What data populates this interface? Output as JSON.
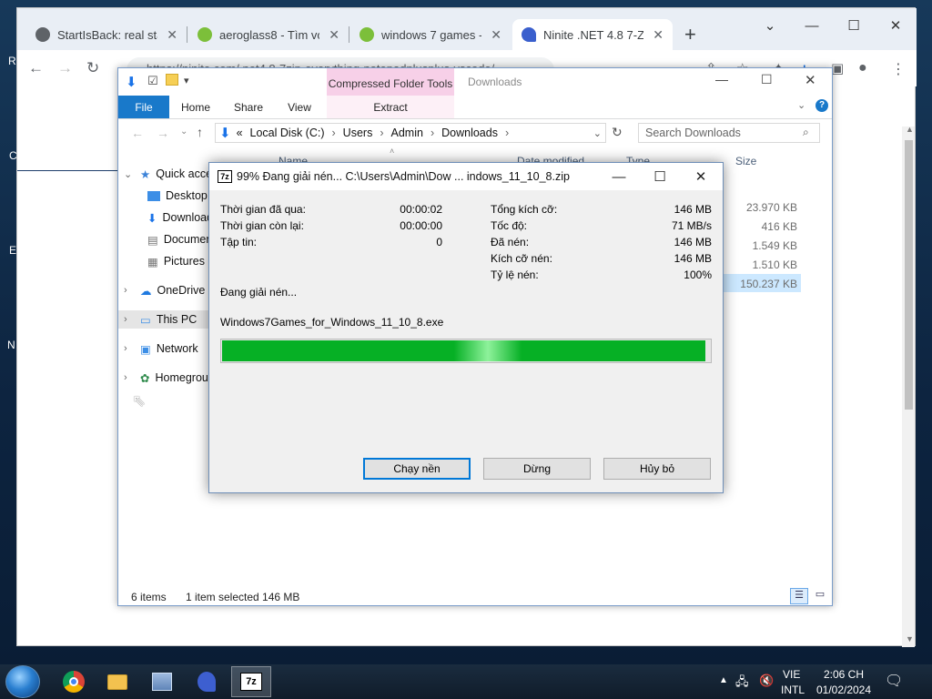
{
  "desktop": {
    "letters": [
      "R",
      "C",
      "E",
      "N"
    ]
  },
  "browser": {
    "tabs": [
      {
        "title": "StartIsBack: real start",
        "icon": "globe-icon"
      },
      {
        "title": "aeroglass8 - Tìm với",
        "icon": "google-favicon"
      },
      {
        "title": "windows 7 games - T",
        "icon": "google-favicon"
      },
      {
        "title": "Ninite .NET 4.8 7-Zip",
        "icon": "ninite-favicon"
      }
    ],
    "new_tab": "+",
    "url": "https://ninite.com/.net4.8-7zip-everything-notepadplusplus-vscode/"
  },
  "explorer": {
    "context_group": "Compressed Folder Tools",
    "window_title": "Downloads",
    "ribbon_tabs": [
      "File",
      "Home",
      "Share",
      "View"
    ],
    "context_tab": "Extract",
    "address": {
      "prefix": "«",
      "parts": [
        "Local Disk (C:)",
        "Users",
        "Admin",
        "Downloads"
      ]
    },
    "search_placeholder": "Search Downloads",
    "columns": {
      "name": "Name",
      "date": "Date modified",
      "type": "Type",
      "size": "Size"
    },
    "nav": {
      "quick_access": "Quick access",
      "desktop": "Desktop",
      "downloads": "Downloads",
      "documents": "Documents",
      "pictures": "Pictures",
      "onedrive": "OneDrive",
      "this_pc": "This PC",
      "network": "Network",
      "homegroup": "Homegroup"
    },
    "sizes": [
      "23.970 KB",
      "416 KB",
      "1.549 KB",
      "1.510 KB",
      "150.237 KB"
    ],
    "status": {
      "items": "6 items",
      "selected": "1 item selected  146 MB"
    }
  },
  "zip": {
    "title": "99% Đang giải nén... C:\\Users\\Admin\\Dow ... indows_11_10_8.zip",
    "logo": "7z",
    "left_stats": [
      {
        "label": "Thời gian đã qua:",
        "value": "00:00:02"
      },
      {
        "label": "Thời gian còn lại:",
        "value": "00:00:00"
      },
      {
        "label": "Tập tin:",
        "value": "0"
      }
    ],
    "right_stats": [
      {
        "label": "Tổng kích cỡ:",
        "value": "146 MB"
      },
      {
        "label": "Tốc độ:",
        "value": "71 MB/s"
      },
      {
        "label": "Đã nén:",
        "value": "146 MB"
      },
      {
        "label": "Kích cỡ nén:",
        "value": "146 MB"
      },
      {
        "label": "Tỷ lệ nén:",
        "value": "100%"
      }
    ],
    "status": "Đang giải nén...",
    "current_file": "Windows7Games_for_Windows_11_10_8.exe",
    "progress": 0.99,
    "buttons": {
      "background": "Chạy nền",
      "pause": "Dừng",
      "cancel": "Hủy bỏ"
    }
  },
  "taskbar": {
    "apps": [
      "chrome-icon",
      "explorer-folder-icon",
      "control-panel-icon",
      "ninite-icon",
      "7zip-icon"
    ],
    "lang_top": "VIE",
    "lang_bottom": "INTL",
    "time": "2:06 CH",
    "date": "01/02/2024"
  },
  "colors": {
    "progress_green": "#06b025",
    "file_tab_blue": "#1979ca",
    "context_pink": "#f7d0e8"
  }
}
